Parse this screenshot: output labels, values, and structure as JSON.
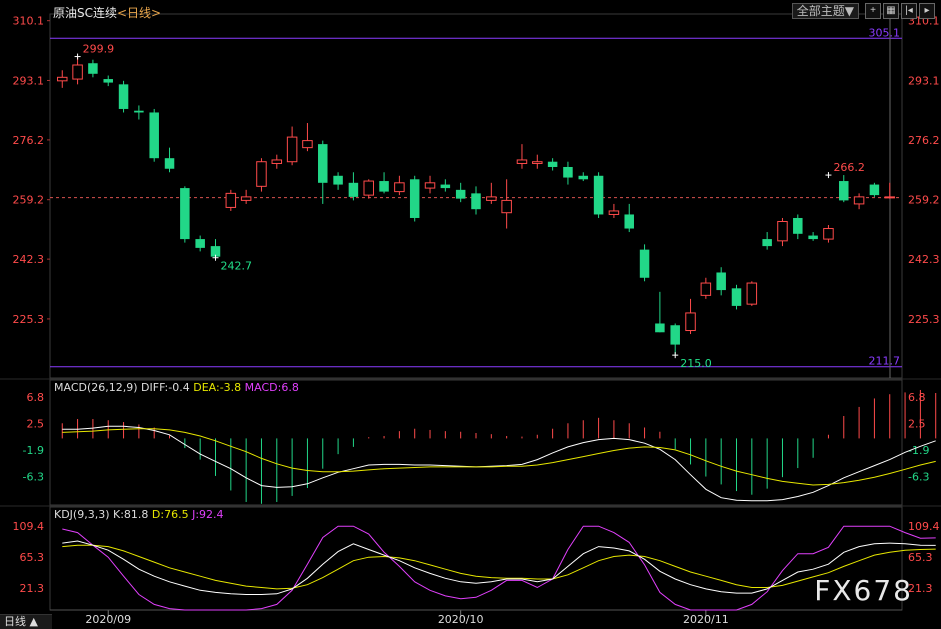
{
  "header": {
    "title": "原油SC连续",
    "period": "<日线>",
    "theme_select": "全部主题▼",
    "buttons": [
      "crosshair-icon",
      "grid-icon",
      "first-icon",
      "next-icon"
    ]
  },
  "footer": {
    "period_label": "日线 ▲",
    "watermark": "FX678"
  },
  "chart_data": [
    {
      "type": "candlestick",
      "title": "原油SC连续",
      "y_ticks": [
        310.1,
        293.1,
        276.2,
        259.2,
        242.3,
        225.3
      ],
      "y_tick_labels": [
        "310.1",
        "293.1",
        "276.2",
        "259.2",
        "242.3",
        "225.3"
      ],
      "ylim": [
        208.5,
        312
      ],
      "x_labels": [
        {
          "index": 3,
          "label": "2020/09"
        },
        {
          "index": 26,
          "label": "2020/10"
        },
        {
          "index": 42,
          "label": "2020/11"
        }
      ],
      "hlines": [
        {
          "value": 305.1,
          "label": "305.1",
          "color": "#8a3cff"
        },
        {
          "value": 211.7,
          "label": "211.7",
          "color": "#8a3cff"
        }
      ],
      "current_price_line": 259.8,
      "annotations": [
        {
          "index": 1,
          "value": 299.9,
          "label": "299.9",
          "color": "#ff4b4b"
        },
        {
          "index": 10,
          "value": 242.7,
          "label": "242.7",
          "color": "#22e08a"
        },
        {
          "index": 40,
          "value": 215.0,
          "label": "215.0",
          "color": "#22e08a"
        },
        {
          "index": 50,
          "value": 266.2,
          "label": "266.2",
          "color": "#ff4b4b"
        }
      ],
      "candles": [
        {
          "o": 293.0,
          "h": 296.0,
          "l": 291.0,
          "c": 294.0
        },
        {
          "o": 293.5,
          "h": 299.9,
          "l": 292.0,
          "c": 297.5
        },
        {
          "o": 298.0,
          "h": 299.0,
          "l": 294.0,
          "c": 295.0
        },
        {
          "o": 293.5,
          "h": 294.5,
          "l": 291.5,
          "c": 292.5
        },
        {
          "o": 292.0,
          "h": 293.0,
          "l": 284.0,
          "c": 285.0
        },
        {
          "o": 284.5,
          "h": 286.0,
          "l": 282.0,
          "c": 284.0
        },
        {
          "o": 284.0,
          "h": 285.0,
          "l": 270.0,
          "c": 271.0
        },
        {
          "o": 271.0,
          "h": 274.0,
          "l": 267.0,
          "c": 268.0
        },
        {
          "o": 262.5,
          "h": 263.0,
          "l": 247.0,
          "c": 248.0
        },
        {
          "o": 248.0,
          "h": 249.0,
          "l": 244.5,
          "c": 245.5
        },
        {
          "o": 246.0,
          "h": 248.0,
          "l": 242.7,
          "c": 243.0
        },
        {
          "o": 257.0,
          "h": 262.0,
          "l": 256.0,
          "c": 261.0
        },
        {
          "o": 259.0,
          "h": 262.0,
          "l": 258.0,
          "c": 260.0
        },
        {
          "o": 263.0,
          "h": 271.0,
          "l": 261.5,
          "c": 270.0
        },
        {
          "o": 269.5,
          "h": 272.0,
          "l": 268.0,
          "c": 270.5
        },
        {
          "o": 270.0,
          "h": 280.0,
          "l": 269.0,
          "c": 277.0
        },
        {
          "o": 274.0,
          "h": 281.0,
          "l": 273.0,
          "c": 276.0
        },
        {
          "o": 275.0,
          "h": 276.0,
          "l": 258.0,
          "c": 264.0
        },
        {
          "o": 266.0,
          "h": 267.0,
          "l": 262.0,
          "c": 263.5
        },
        {
          "o": 264.0,
          "h": 267.0,
          "l": 259.0,
          "c": 260.0
        },
        {
          "o": 260.5,
          "h": 265.0,
          "l": 259.5,
          "c": 264.5
        },
        {
          "o": 264.5,
          "h": 267.0,
          "l": 261.0,
          "c": 261.5
        },
        {
          "o": 261.5,
          "h": 266.0,
          "l": 260.5,
          "c": 264.0
        },
        {
          "o": 265.0,
          "h": 266.0,
          "l": 253.0,
          "c": 254.0
        },
        {
          "o": 262.5,
          "h": 266.0,
          "l": 261.0,
          "c": 264.0
        },
        {
          "o": 263.5,
          "h": 265.0,
          "l": 261.5,
          "c": 262.5
        },
        {
          "o": 262.0,
          "h": 264.0,
          "l": 258.5,
          "c": 259.5
        },
        {
          "o": 261.0,
          "h": 263.0,
          "l": 255.0,
          "c": 256.5
        },
        {
          "o": 259.0,
          "h": 264.0,
          "l": 258.0,
          "c": 260.0
        },
        {
          "o": 255.5,
          "h": 265.0,
          "l": 251.0,
          "c": 259.0
        },
        {
          "o": 269.5,
          "h": 275.0,
          "l": 268.0,
          "c": 270.5
        },
        {
          "o": 269.5,
          "h": 272.0,
          "l": 268.0,
          "c": 270.0
        },
        {
          "o": 270.0,
          "h": 271.0,
          "l": 267.5,
          "c": 268.5
        },
        {
          "o": 268.5,
          "h": 270.0,
          "l": 263.5,
          "c": 265.5
        },
        {
          "o": 266.0,
          "h": 267.0,
          "l": 264.5,
          "c": 265.0
        },
        {
          "o": 266.0,
          "h": 267.0,
          "l": 254.0,
          "c": 255.0
        },
        {
          "o": 255.0,
          "h": 258.0,
          "l": 254.0,
          "c": 256.0
        },
        {
          "o": 255.0,
          "h": 258.0,
          "l": 250.0,
          "c": 251.0
        },
        {
          "o": 245.0,
          "h": 246.5,
          "l": 236.0,
          "c": 237.0
        },
        {
          "o": 224.0,
          "h": 233.0,
          "l": 221.5,
          "c": 221.5
        },
        {
          "o": 223.5,
          "h": 224.0,
          "l": 215.0,
          "c": 218.0
        },
        {
          "o": 222.0,
          "h": 231.0,
          "l": 221.0,
          "c": 227.0
        },
        {
          "o": 232.0,
          "h": 237.0,
          "l": 231.0,
          "c": 235.5
        },
        {
          "o": 238.5,
          "h": 240.0,
          "l": 232.0,
          "c": 233.5
        },
        {
          "o": 234.0,
          "h": 235.0,
          "l": 228.0,
          "c": 229.0
        },
        {
          "o": 229.5,
          "h": 236.0,
          "l": 229.0,
          "c": 235.5
        },
        {
          "o": 248.0,
          "h": 250.0,
          "l": 245.0,
          "c": 246.0
        },
        {
          "o": 247.5,
          "h": 254.0,
          "l": 246.0,
          "c": 253.0
        },
        {
          "o": 254.0,
          "h": 255.0,
          "l": 248.0,
          "c": 249.5
        },
        {
          "o": 249.0,
          "h": 250.0,
          "l": 247.5,
          "c": 248.0
        },
        {
          "o": 248.0,
          "h": 252.0,
          "l": 247.0,
          "c": 251.0
        },
        {
          "o": 264.5,
          "h": 266.2,
          "l": 258.5,
          "c": 259.0
        },
        {
          "o": 258.0,
          "h": 261.0,
          "l": 256.5,
          "c": 260.0
        },
        {
          "o": 263.5,
          "h": 264.0,
          "l": 260.0,
          "c": 260.5
        },
        {
          "o": 260.0,
          "h": 264.0,
          "l": 259.5,
          "c": 260.0
        }
      ]
    },
    {
      "type": "macd",
      "title": "MACD(26,12,9)",
      "diff_label": "DIFF:-0.4",
      "dea_label": "DEA:-3.8",
      "macd_label": "MACD:6.8",
      "y_ticks": [
        6.8,
        2.5,
        -1.9,
        -6.3
      ],
      "y_tick_labels": [
        "6.8",
        "2.5",
        "-1.9",
        "-6.3"
      ],
      "ylim": [
        -11.0,
        7.5
      ],
      "hist": [
        2.5,
        3.2,
        3.2,
        3.0,
        2.7,
        2.3,
        1.8,
        0.5,
        -1.6,
        -3.5,
        -6.2,
        -8.6,
        -10.5,
        -10.8,
        -10.5,
        -9.5,
        -8.2,
        -5.0,
        -2.6,
        -1.4,
        0.2,
        0.4,
        1.2,
        1.6,
        1.4,
        1.2,
        1.1,
        0.9,
        0.7,
        0.4,
        0.3,
        0.6,
        1.6,
        2.5,
        3.0,
        3.4,
        3.0,
        2.5,
        1.8,
        1.1,
        -1.8,
        -4.3,
        -6.3,
        -7.6,
        -8.7,
        -9.3,
        -8.3,
        -6.4,
        -4.9,
        -3.2,
        0.6,
        3.7,
        5.2,
        6.6,
        7.3,
        7.6,
        8.0,
        7.5
      ],
      "diff": [
        1.5,
        1.5,
        1.7,
        2.0,
        2.0,
        1.8,
        1.3,
        0.6,
        -1.0,
        -2.6,
        -3.8,
        -5.0,
        -6.5,
        -7.8,
        -8.1,
        -8.0,
        -7.5,
        -6.5,
        -5.6,
        -5.0,
        -4.4,
        -4.3,
        -4.3,
        -4.4,
        -4.4,
        -4.5,
        -4.6,
        -4.7,
        -4.6,
        -4.5,
        -4.3,
        -3.5,
        -2.4,
        -1.4,
        -0.7,
        -0.2,
        0.0,
        -0.2,
        -0.8,
        -1.8,
        -3.5,
        -6.0,
        -8.4,
        -9.8,
        -10.2,
        -10.3,
        -10.3,
        -10.1,
        -9.6,
        -8.9,
        -7.8,
        -6.5,
        -5.5,
        -4.5,
        -3.5,
        -2.3,
        -1.3,
        -0.4
      ],
      "dea": [
        1.0,
        1.1,
        1.2,
        1.4,
        1.5,
        1.6,
        1.6,
        1.4,
        1.0,
        0.4,
        -0.4,
        -1.3,
        -2.2,
        -3.3,
        -4.2,
        -4.9,
        -5.3,
        -5.5,
        -5.5,
        -5.4,
        -5.2,
        -5.0,
        -4.9,
        -4.8,
        -4.7,
        -4.7,
        -4.7,
        -4.7,
        -4.7,
        -4.6,
        -4.6,
        -4.4,
        -4.0,
        -3.5,
        -3.0,
        -2.5,
        -2.0,
        -1.6,
        -1.4,
        -1.5,
        -1.9,
        -2.7,
        -3.7,
        -4.6,
        -5.4,
        -6.0,
        -6.6,
        -7.1,
        -7.4,
        -7.7,
        -7.6,
        -7.3,
        -6.9,
        -6.4,
        -5.8,
        -5.1,
        -4.4,
        -3.8
      ]
    },
    {
      "type": "kdj",
      "title": "KDJ(9,3,3)",
      "k_label": "K:81.8",
      "d_label": "D:76.5",
      "j_label": "J:92.4",
      "y_ticks": [
        109.4,
        65.3,
        21.3
      ],
      "y_tick_labels": [
        "109.4",
        "65.3",
        "21.3"
      ],
      "ylim": [
        -10,
        115
      ],
      "k": [
        85,
        88,
        82,
        75,
        62,
        48,
        38,
        30,
        24,
        18,
        15,
        13,
        12,
        12,
        13,
        20,
        35,
        55,
        73,
        84,
        76,
        68,
        60,
        50,
        42,
        35,
        30,
        28,
        30,
        34,
        34,
        30,
        34,
        52,
        70,
        80,
        78,
        74,
        62,
        45,
        34,
        26,
        20,
        16,
        14,
        14,
        20,
        32,
        44,
        48,
        55,
        72,
        80,
        84,
        85,
        84,
        82,
        81.8
      ],
      "d": [
        80,
        82,
        82,
        80,
        74,
        66,
        58,
        50,
        44,
        38,
        32,
        28,
        24,
        22,
        20,
        21,
        26,
        36,
        48,
        60,
        65,
        66,
        64,
        60,
        54,
        48,
        42,
        38,
        36,
        35,
        35,
        34,
        34,
        40,
        50,
        60,
        66,
        68,
        66,
        60,
        52,
        44,
        38,
        32,
        26,
        22,
        22,
        25,
        31,
        37,
        43,
        52,
        60,
        68,
        72,
        75,
        76,
        76.5
      ],
      "j": [
        105,
        100,
        82,
        65,
        38,
        12,
        -2,
        -8,
        -10,
        -10,
        -10,
        -10,
        -10,
        -8,
        -2,
        18,
        55,
        93,
        109,
        109,
        98,
        72,
        52,
        30,
        18,
        10,
        6,
        8,
        18,
        32,
        32,
        22,
        34,
        76,
        109,
        109,
        100,
        86,
        54,
        15,
        -2,
        -10,
        -10,
        -10,
        -10,
        -2,
        16,
        46,
        70,
        70,
        79,
        109,
        109,
        109,
        109,
        100,
        92,
        92.4
      ]
    }
  ]
}
